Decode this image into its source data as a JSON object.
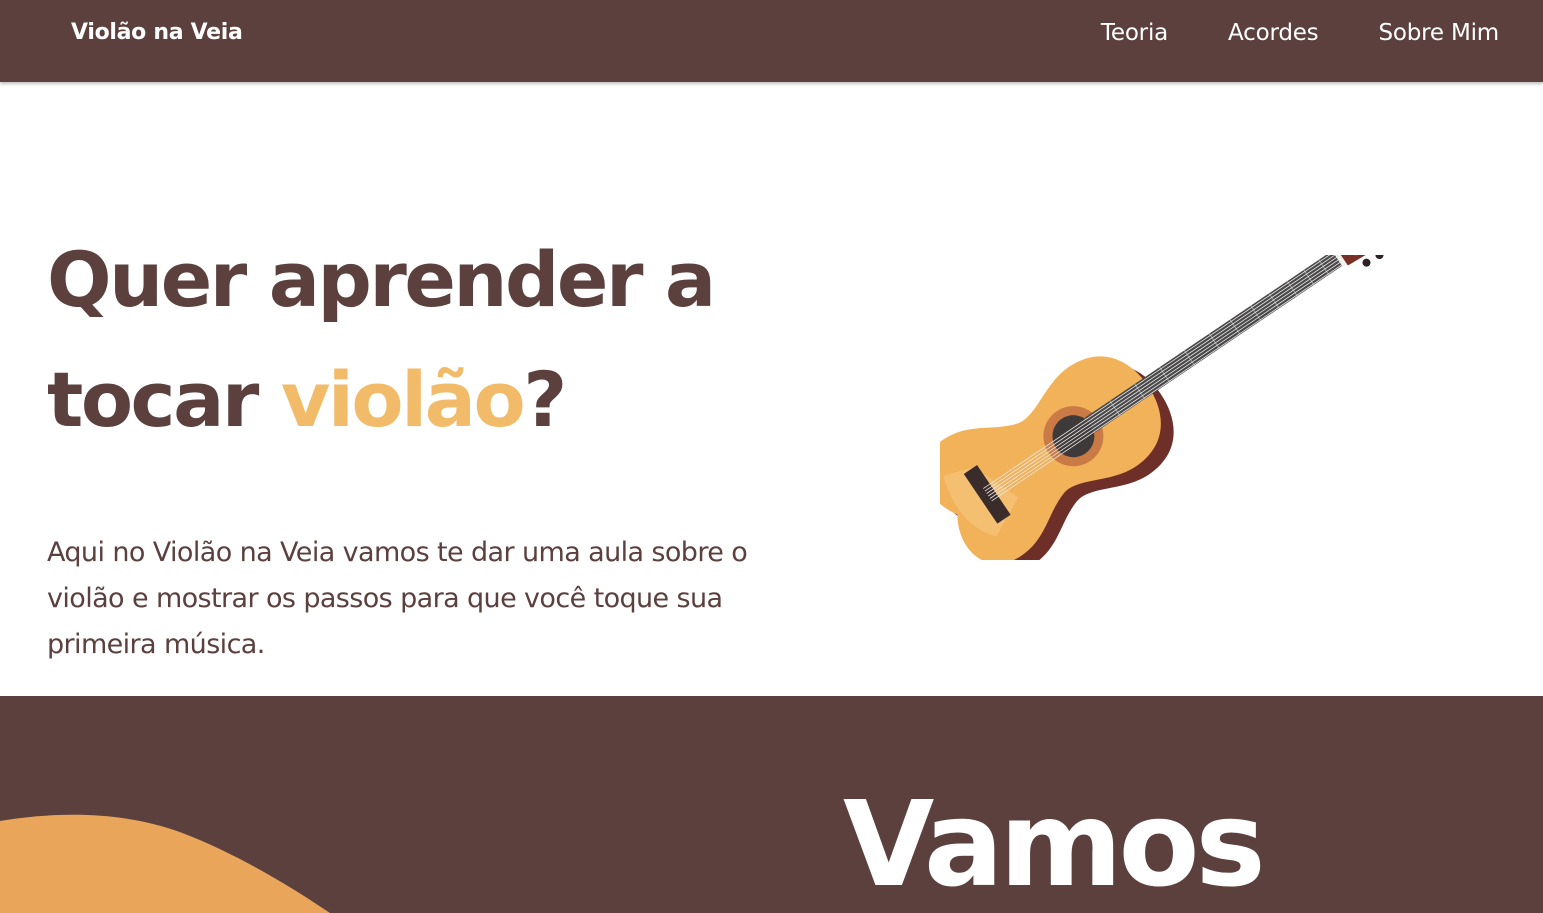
{
  "header": {
    "brand": "Violão na Veia",
    "nav": [
      {
        "label": "Teoria"
      },
      {
        "label": "Acordes"
      },
      {
        "label": "Sobre Mim"
      }
    ]
  },
  "hero": {
    "title_line1": "Quer aprender a",
    "title_line2_prefix": "tocar ",
    "title_accent": "violão",
    "title_suffix": "?",
    "description": "Aqui no Violão na Veia vamos te dar uma aula sobre o violão e mostrar os passos para que você toque sua primeira música."
  },
  "section2": {
    "title": "Vamos"
  },
  "colors": {
    "primary": "#5c403d",
    "accent": "#f1bb69",
    "blob": "#e9a65b",
    "background": "#ffffff"
  }
}
